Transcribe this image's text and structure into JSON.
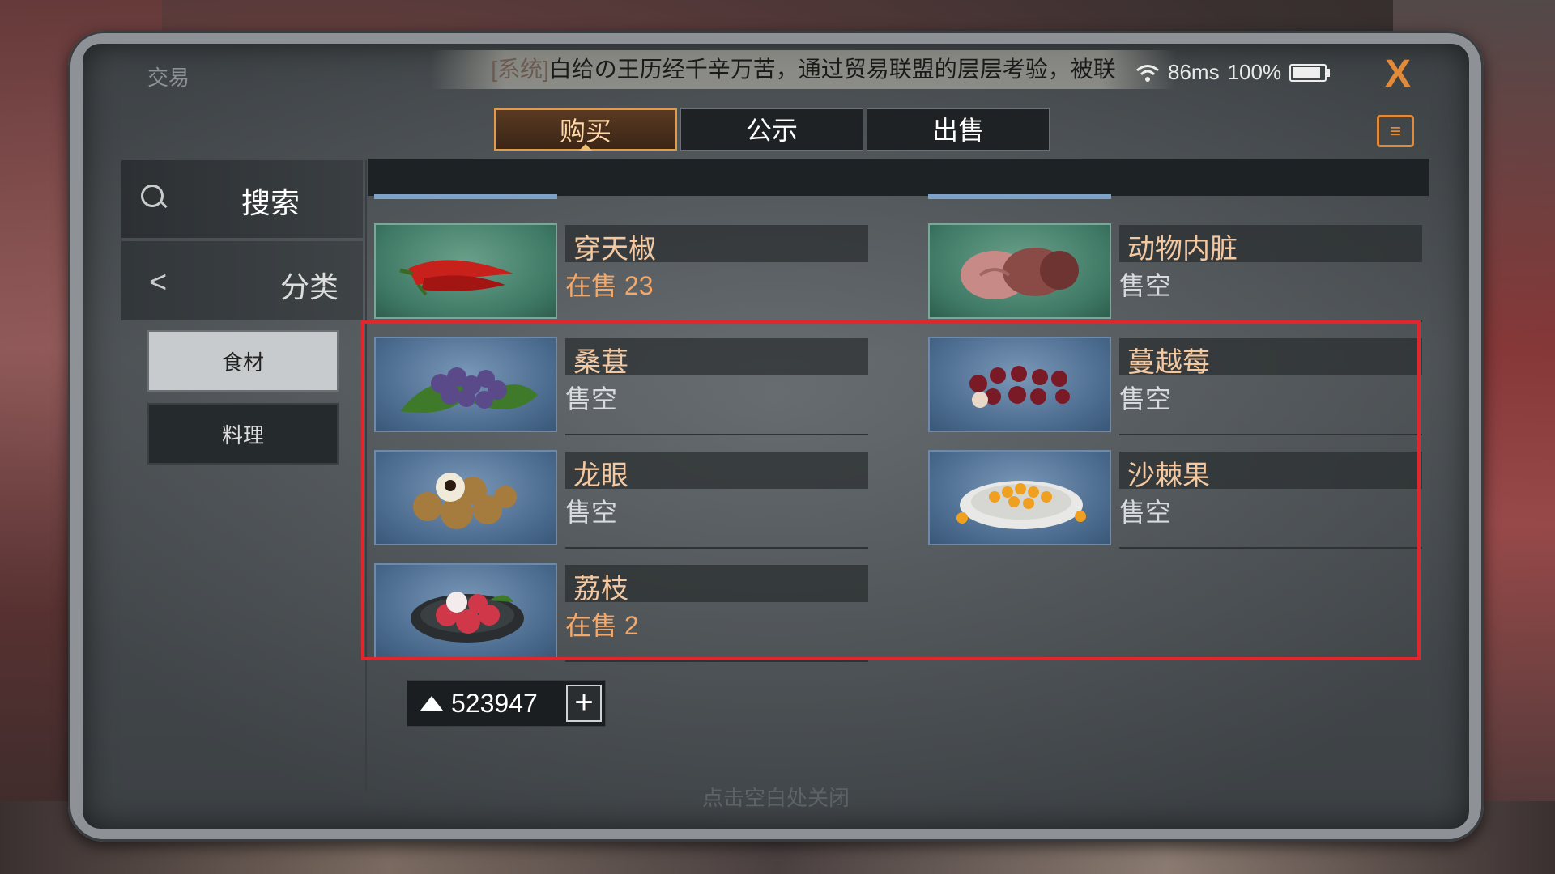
{
  "window": {
    "title": "交易",
    "ticker_prefix": "[系统]",
    "ticker_text": "白给の王历经千辛万苦，通过贸易联盟的层层考验，被联",
    "ping": "86ms",
    "battery": "100%",
    "close_label": "X"
  },
  "tabs": [
    {
      "label": "购买",
      "active": true
    },
    {
      "label": "公示",
      "active": false
    },
    {
      "label": "出售",
      "active": false
    }
  ],
  "sidebar": {
    "search_label": "搜索",
    "category_label": "分类",
    "back_glyph": "<",
    "subcategories": [
      "食材",
      "料理"
    ]
  },
  "items": [
    {
      "name": "穿天椒",
      "stock": "在售 23",
      "icon": "chili-pepper-icon",
      "available": true
    },
    {
      "name": "动物内脏",
      "stock": "售空",
      "icon": "organ-meat-icon",
      "available": false
    },
    {
      "name": "桑葚",
      "stock": "售空",
      "icon": "mulberry-icon",
      "available": false
    },
    {
      "name": "蔓越莓",
      "stock": "售空",
      "icon": "cranberry-icon",
      "available": false
    },
    {
      "name": "龙眼",
      "stock": "售空",
      "icon": "longan-icon",
      "available": false
    },
    {
      "name": "沙棘果",
      "stock": "售空",
      "icon": "sea-buckthorn-icon",
      "available": false
    },
    {
      "name": "荔枝",
      "stock": "在售 2",
      "icon": "lychee-icon",
      "available": true
    }
  ],
  "currency": {
    "amount": "523947",
    "plus": "+"
  },
  "hint": "点击空白处关闭",
  "colors": {
    "accent": "#e39a4a",
    "highlight": "#e0272d",
    "available": "#f4a86a"
  }
}
